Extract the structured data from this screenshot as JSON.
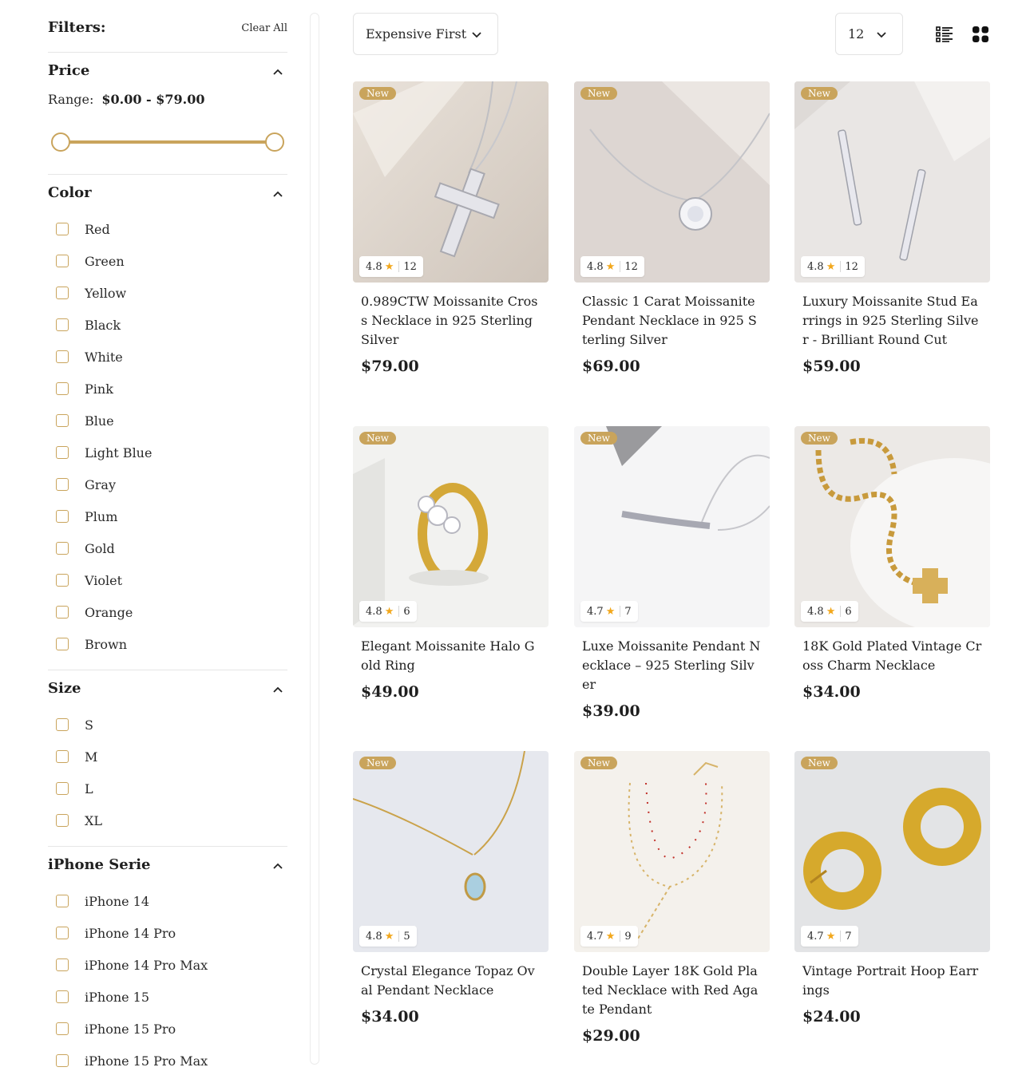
{
  "filters": {
    "title": "Filters:",
    "clear_all": "Clear All",
    "price": {
      "title": "Price",
      "range_label": "Range:",
      "range_value": "$0.00 - $79.00",
      "min": 0,
      "max": 79,
      "selected_min": 0,
      "selected_max": 79
    },
    "color": {
      "title": "Color",
      "options": [
        "Red",
        "Green",
        "Yellow",
        "Black",
        "White",
        "Pink",
        "Blue",
        "Light Blue",
        "Gray",
        "Plum",
        "Gold",
        "Violet",
        "Orange",
        "Brown"
      ]
    },
    "size": {
      "title": "Size",
      "options": [
        "S",
        "M",
        "L",
        "XL"
      ]
    },
    "iphone": {
      "title": "iPhone Serie",
      "options": [
        "iPhone 14",
        "iPhone 14 Pro",
        "iPhone 14 Pro Max",
        "iPhone 15",
        "iPhone 15 Pro",
        "iPhone 15 Pro Max"
      ]
    }
  },
  "toolbar": {
    "sort": "Expensive First",
    "per_page": "12",
    "list_icon": "list-view-icon",
    "grid_icon": "grid-view-icon"
  },
  "colors": {
    "accent": "#c9a45c",
    "star": "#f2a71b",
    "text": "#1f1f1f"
  },
  "products": [
    {
      "badge": "New",
      "rating": "4.8",
      "reviews": "12",
      "title": "0.989CTW Moissanite Cross Necklace in 925 Sterling Silver",
      "price": "$79.00"
    },
    {
      "badge": "New",
      "rating": "4.8",
      "reviews": "12",
      "title": "Classic 1 Carat Moissanite Pendant Necklace in 925 Sterling Silver",
      "price": "$69.00"
    },
    {
      "badge": "New",
      "rating": "4.8",
      "reviews": "12",
      "title": "Luxury Moissanite Stud Earrings in 925 Sterling Silver - Brilliant Round Cut",
      "price": "$59.00"
    },
    {
      "badge": "New",
      "rating": "4.8",
      "reviews": "6",
      "title": "Elegant Moissanite Halo Gold Ring",
      "price": "$49.00"
    },
    {
      "badge": "New",
      "rating": "4.7",
      "reviews": "7",
      "title": "Luxe Moissanite Pendant Necklace – 925 Sterling Silver",
      "price": "$39.00"
    },
    {
      "badge": "New",
      "rating": "4.8",
      "reviews": "6",
      "title": "18K Gold Plated Vintage Cross Charm Necklace",
      "price": "$34.00"
    },
    {
      "badge": "New",
      "rating": "4.8",
      "reviews": "5",
      "title": "Crystal Elegance Topaz Oval Pendant Necklace",
      "price": "$34.00"
    },
    {
      "badge": "New",
      "rating": "4.7",
      "reviews": "9",
      "title": "Double Layer 18K Gold Plated Necklace with Red Agate Pendant",
      "price": "$29.00"
    },
    {
      "badge": "New",
      "rating": "4.7",
      "reviews": "7",
      "title": "Vintage Portrait Hoop Earrings",
      "price": "$24.00"
    }
  ]
}
